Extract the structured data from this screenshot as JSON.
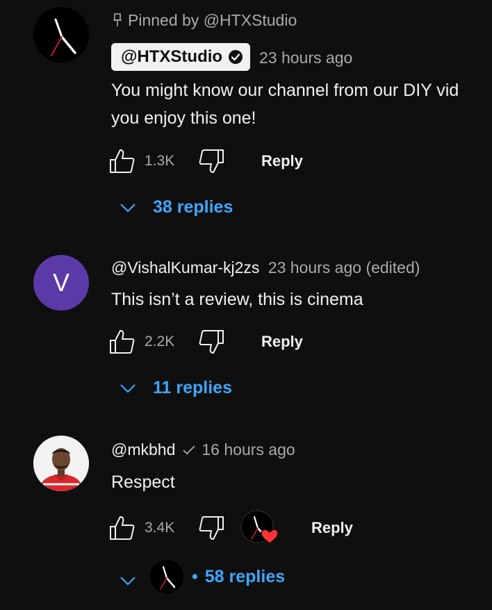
{
  "comments": [
    {
      "pinned_label": "Pinned by @HTXStudio",
      "author": "@HTXStudio",
      "time": "23 hours ago",
      "text_line1": "You might know our channel from our DIY vid",
      "text_line2": "you enjoy this one!",
      "likes": "1.3K",
      "reply_label": "Reply",
      "replies_label": "38 replies"
    },
    {
      "author": "@VishalKumar-kj2zs",
      "time": "23 hours ago (edited)",
      "avatar_letter": "V",
      "text": "This isn’t a review, this is cinema",
      "likes": "2.2K",
      "reply_label": "Reply",
      "replies_label": "11 replies"
    },
    {
      "author": "@mkbhd",
      "time": "16 hours ago",
      "text": "Respect",
      "likes": "3.4K",
      "reply_label": "Reply",
      "replies_label": "58 replies",
      "separator": "•"
    }
  ],
  "colors": {
    "background": "#0f0f0f",
    "link": "#3ea6ff",
    "muted": "#aaaaaa",
    "heart": "#ff3333"
  },
  "icons": [
    "pin-icon",
    "verified-icon",
    "like-icon",
    "dislike-icon",
    "chevron-down-icon",
    "heart-icon",
    "check-icon"
  ]
}
